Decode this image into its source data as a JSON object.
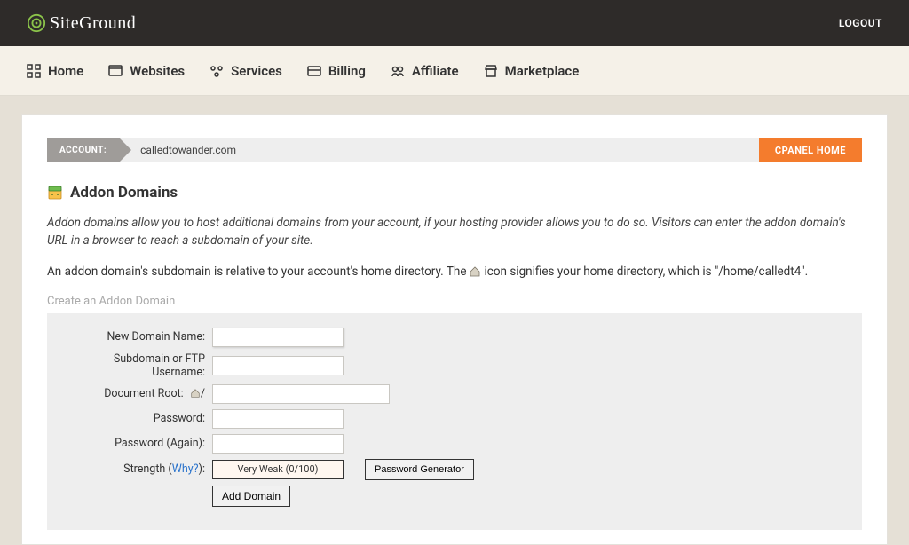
{
  "header": {
    "brand": "SiteGround",
    "logout": "LOGOUT"
  },
  "nav": {
    "home": "Home",
    "websites": "Websites",
    "services": "Services",
    "billing": "Billing",
    "affiliate": "Affiliate",
    "marketplace": "Marketplace"
  },
  "account": {
    "label": "ACCOUNT:",
    "domain": "calledtowander.com",
    "cpanel": "CPANEL HOME"
  },
  "section": {
    "title": "Addon Domains",
    "description": "Addon domains allow you to host additional domains from your account, if your hosting provider allows you to do so. Visitors can enter the addon domain's URL in a browser to reach a subdomain of your site.",
    "description2_pre": "An addon domain's subdomain is relative to your account's home directory. The ",
    "description2_post": " icon signifies your home directory, which is \"/home/calledt4\".",
    "form_title": "Create an Addon Domain"
  },
  "form": {
    "labels": {
      "new_domain": "New Domain Name:",
      "subdomain": "Subdomain or FTP Username:",
      "doc_root": "Document Root:",
      "password": "Password:",
      "password_again": "Password (Again):",
      "strength_pre": "Strength (",
      "strength_link": "Why?",
      "strength_post": "):"
    },
    "doc_root_slash": "/",
    "strength_value": "Very Weak (0/100)",
    "password_generator": "Password Generator",
    "add_button": "Add Domain"
  }
}
